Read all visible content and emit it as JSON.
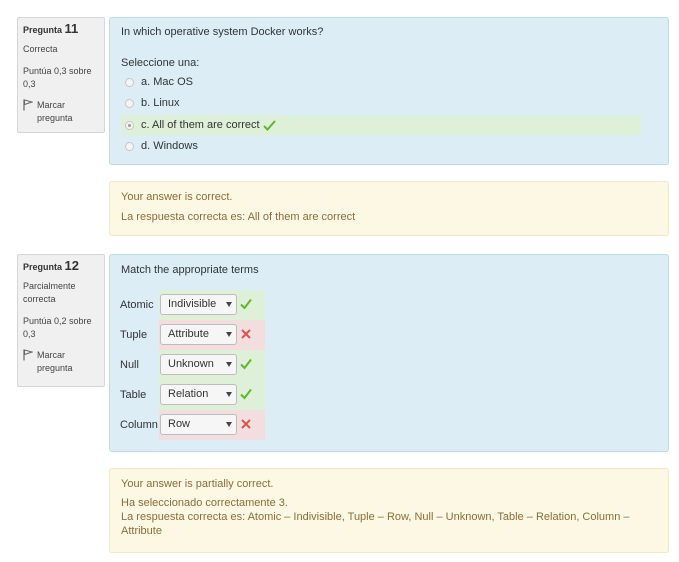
{
  "question11": {
    "info": {
      "label": "Pregunta",
      "number": "11",
      "state": "Correcta",
      "grade": "Puntúa 0,3 sobre 0,3",
      "flag": "Marcar pregunta"
    },
    "text": "In which operative system Docker works?",
    "prompt": "Seleccione una:",
    "options": [
      {
        "label": "a. Mac OS",
        "selected": false,
        "correct": false
      },
      {
        "label": "b. Linux",
        "selected": false,
        "correct": false
      },
      {
        "label": "c. All of them are correct",
        "selected": true,
        "correct": true
      },
      {
        "label": "d. Windows",
        "selected": false,
        "correct": false
      }
    ],
    "feedback": {
      "status": "Your answer is correct.",
      "right_answer": "La respuesta correcta es: All of them are correct"
    }
  },
  "question12": {
    "info": {
      "label": "Pregunta",
      "number": "12",
      "state": "Parcialmente correcta",
      "grade": "Puntúa 0,2 sobre 0,3",
      "flag": "Marcar pregunta"
    },
    "text": "Match the appropriate terms",
    "rows": [
      {
        "term": "Atomic",
        "value": "Indivisible",
        "correct": true
      },
      {
        "term": "Tuple",
        "value": "Attribute",
        "correct": false
      },
      {
        "term": "Null",
        "value": "Unknown",
        "correct": true
      },
      {
        "term": "Table",
        "value": "Relation",
        "correct": true
      },
      {
        "term": "Column",
        "value": "Row",
        "correct": false
      }
    ],
    "feedback": {
      "status": "Your answer is partially correct.",
      "num_correct": "Ha seleccionado correctamente 3.",
      "right_answer": "La respuesta correcta es: Atomic – Indivisible, Tuple – Row, Null – Unknown, Table – Relation, Column – Attribute"
    }
  },
  "colors": {
    "formulation_bg": "#dcedf6",
    "feedback_bg": "#fcf8e3",
    "feedback_text": "#8a6d3b",
    "correct_bg": "#dff0d8",
    "incorrect_bg": "#f2dede",
    "tick": "#5cb82e",
    "cross": "#d9534f"
  }
}
